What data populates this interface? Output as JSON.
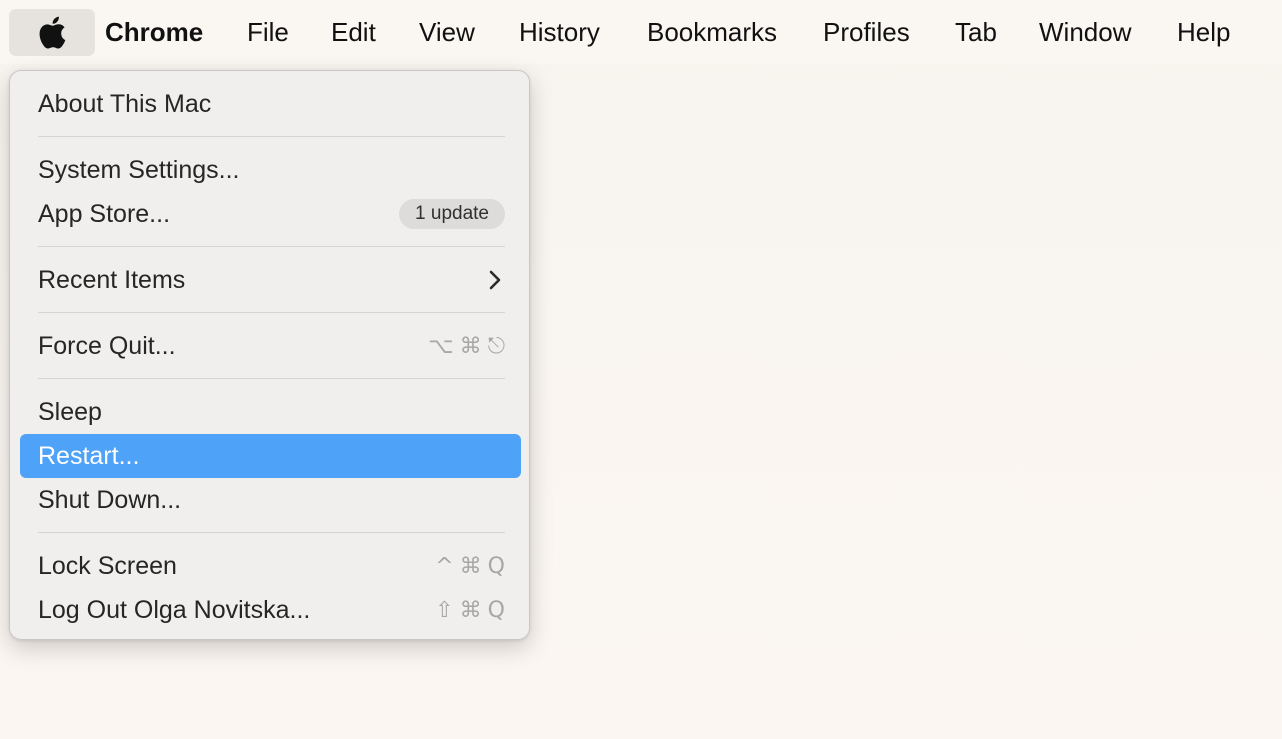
{
  "menubar": {
    "apple_icon": "apple-logo-icon",
    "app_name": "Chrome",
    "menus": [
      "File",
      "Edit",
      "View",
      "History",
      "Bookmarks",
      "Profiles",
      "Tab",
      "Window",
      "Help"
    ]
  },
  "apple_menu": {
    "items": [
      {
        "label": "About This Mac"
      },
      {
        "label": "System Settings..."
      },
      {
        "label": "App Store...",
        "badge": "1 update"
      },
      {
        "label": "Recent Items",
        "submenu_icon": "chevron-right-icon"
      },
      {
        "label": "Force Quit...",
        "shortcut": [
          "⌥",
          "⌘",
          "⎋"
        ]
      },
      {
        "label": "Sleep"
      },
      {
        "label": "Restart...",
        "highlighted": true
      },
      {
        "label": "Shut Down..."
      },
      {
        "label": "Lock Screen",
        "shortcut": [
          "^",
          "⌘",
          "Q"
        ]
      },
      {
        "label": "Log Out Olga Novitska...",
        "shortcut": [
          "⇧",
          "⌘",
          "Q"
        ]
      }
    ]
  },
  "colors": {
    "highlight": "#4ea2f8",
    "background": "#f8f4ef",
    "menu_background": "#f0efee",
    "shortcut_text": "#a9a7a5"
  }
}
